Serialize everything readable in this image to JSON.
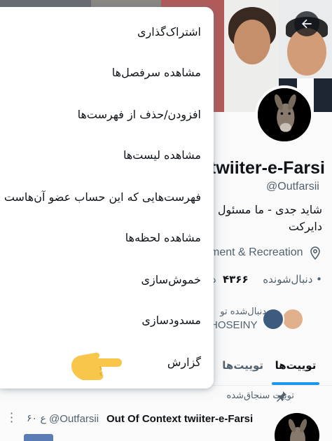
{
  "profile": {
    "display_name": "twiiter-e-Farsi",
    "handle": "@Outfarsii",
    "bio_line1": "شاید جدی - ما مسئول نظ",
    "bio_line2": "دایرکت",
    "category": "ment & Recreation",
    "following_count": "۴۳۶۶",
    "following_suffix": "د",
    "followers_label": "• دنبال‌شونده",
    "followed_by_label": "دنبال‌شده تو",
    "followed_by_name": "HOSEINY"
  },
  "tabs": {
    "tweets": "توییت‌ها",
    "replies": "توییت‌ها"
  },
  "pinned": {
    "label": "توییت سنجاق‌شده",
    "author": "Out Of Context twiiter-e-Farsi",
    "handle": "@Outfarsii",
    "time": "۶۰ ع"
  },
  "menu": {
    "items": [
      "اشتراک‌گذاری",
      "مشاهده سرفصل‌ها",
      "افزودن/حذف از فهرست‌ها",
      "مشاهده لیست‌ها",
      "فهرست‌هایی که این حساب عضو آن‌هاست",
      "مشاهده لحظه‌ها",
      "خموش‌سازی",
      "مسدودسازی",
      "گزارش"
    ]
  },
  "colors": {
    "accent": "#1d9bf0",
    "text_primary": "#0f1419",
    "text_secondary": "#536471",
    "hand_emoji": "#f7c64a"
  },
  "icons": {
    "back": "arrow-left-icon",
    "location": "location-pin-icon",
    "pin": "pushpin-icon",
    "more": "more-vertical-icon",
    "pointing": "pointing-right-hand-icon"
  }
}
